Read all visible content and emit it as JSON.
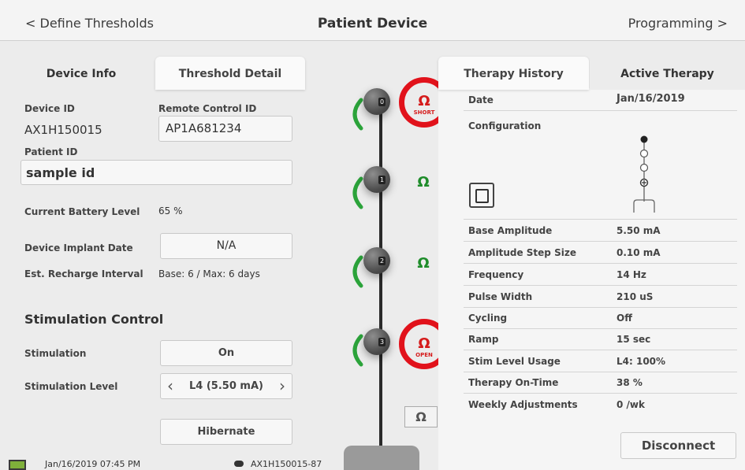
{
  "header": {
    "back_label": "<  Define Thresholds",
    "title": "Patient Device",
    "forward_label": "Programming  >"
  },
  "left_tabs": [
    "Device Info",
    "Threshold Detail"
  ],
  "right_tabs": [
    "Therapy History",
    "Active Therapy"
  ],
  "device_info": {
    "device_id_label": "Device ID",
    "device_id": "AX1H150015",
    "remote_id_label": "Remote Control ID",
    "remote_id": "AP1A681234",
    "patient_id_label": "Patient ID",
    "patient_id": "sample id",
    "battery_label": "Current Battery Level",
    "battery_value": "65 %",
    "implant_date_label": "Device Implant Date",
    "implant_date": "N/A",
    "recharge_label": "Est. Recharge Interval",
    "recharge_value": "Base: 6 / Max: 6 days"
  },
  "stimulation": {
    "section_title": "Stimulation Control",
    "stim_label": "Stimulation",
    "stim_value": "On",
    "level_label": "Stimulation Level",
    "level_value": "L4 (5.50 mA)",
    "hibernate_label": "Hibernate"
  },
  "lead": {
    "electrodes": [
      {
        "num": "0",
        "status": "SHORT"
      },
      {
        "num": "1",
        "status": ""
      },
      {
        "num": "2",
        "status": ""
      },
      {
        "num": "3",
        "status": "OPEN"
      }
    ],
    "ohm_symbol": "Ω",
    "impedance_button": "Ω"
  },
  "therapy": {
    "date_label": "Date",
    "date_value": "Jan/16/2019",
    "configuration_label": "Configuration",
    "rows": [
      {
        "label": "Base Amplitude",
        "value": "5.50 mA"
      },
      {
        "label": "Amplitude Step Size",
        "value": "0.10 mA"
      },
      {
        "label": "Frequency",
        "value": "14 Hz"
      },
      {
        "label": "Pulse Width",
        "value": "210 uS"
      },
      {
        "label": "Cycling",
        "value": "Off"
      },
      {
        "label": "Ramp",
        "value": "15 sec"
      },
      {
        "label": "Stim Level Usage",
        "value": "L4: 100%"
      },
      {
        "label": "Therapy On-Time",
        "value": "38 %"
      },
      {
        "label": "Weekly Adjustments",
        "value": "0 /wk"
      }
    ],
    "disconnect_label": "Disconnect"
  },
  "status_bar": {
    "timestamp": "Jan/16/2019 07:45 PM",
    "device_conn": "AX1H150015-87"
  },
  "colors": {
    "alert_red": "#e1121b",
    "ok_green": "#1e8c2a"
  }
}
